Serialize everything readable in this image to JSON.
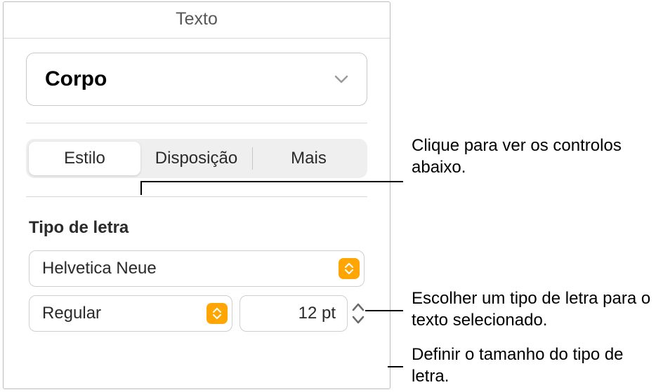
{
  "panel": {
    "title": "Texto",
    "paragraphStyle": "Corpo",
    "tabs": {
      "style": "Estilo",
      "layout": "Disposição",
      "more": "Mais"
    },
    "font": {
      "sectionLabel": "Tipo de letra",
      "family": "Helvetica Neue",
      "weight": "Regular",
      "size": "12 pt"
    }
  },
  "callouts": {
    "tabs": "Clique para ver os controlos abaixo.",
    "fontFamily": "Escolher um tipo de letra para o texto selecionado.",
    "fontSize": "Definir o tamanho do tipo de letra."
  }
}
